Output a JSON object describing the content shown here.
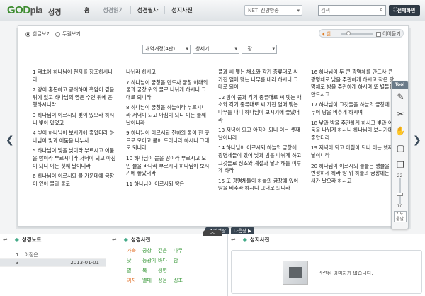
{
  "header": {
    "logo_main": "GOD",
    "logo_pia": "pia",
    "logo_sub": "성경",
    "nav": [
      "홈",
      "성경읽기",
      "성경필사",
      "성지사진"
    ],
    "net_label": "NET",
    "net_value": "진양방송",
    "search_placeholder": "검색",
    "fullscreen_label": "전체화면"
  },
  "controls": {
    "radio_korean": "한글보기",
    "radio_dual": "두권보기",
    "audio_icon": "◖ 한",
    "continuous_label": "이어듣기",
    "version": "개역개정(4판)",
    "book": "창세기",
    "chapter": "1장"
  },
  "columns": [
    [
      "1 태초에 하나님이 천지를 창조하시니라",
      "2 땅이 혼돈하고 공허하며 흑암이 깊음 위에 있고 하나님의 영은 수면 위에 운행하시니라",
      "3 하나님이 이르시되 빛이 있으라 하시니 빛이 있었고",
      "4 빛이 하나님이 보시기에 좋았더라 하나님이 빛과 어둠을 나누사",
      "5 하나님이 빛을 낮이라 부르시고 어둠을 밤이라 부르시니라 저녁이 되고 아침이 되니 이는 첫째 날이니라",
      "6 하나님이 이르시되 물 가운데에 궁창이 있어 물과 물로"
    ],
    [
      "나뉘라 하시고",
      "7 하나님이 궁창을 만드사 궁창 아래의 물과 궁창 위의 물로 나뉘게 하시니 그대로 되니라",
      "8 하나님이 궁창을 하늘이라 부르시니라 저녁이 되고 아침이 되니 이는 둘째 날이니라",
      "9 하나님이 이르시되 천하의 물이 한 곳으로 모이고 뭍이 드러나라 하시니 그대로 되니라",
      "10 하나님이 뭍을 땅이라 부르시고 모인 물을 바다라 부르시니 하나님이 보시기에 좋았더라",
      "11 하나님이 이르시되 땅은"
    ],
    [
      "풀과 씨 맺는 채소와 각기 종류대로 씨 가진 열매 맺는 나무를 내라 하시니 그대로 되어",
      "12 땅이 풀과 각기 종류대로 씨 맺는 채소와 각기 종류대로 씨 가진 열매 맺는 나무를 내니 하나님이 보시기에 좋았더라",
      "13 저녁이 되고 아침이 되니 이는 셋째 날이니라",
      "14 하나님이 이르시되 하늘의 궁창에 광명체들이 있어 낮과 밤을 나뉘게 하고 그것들로 징조와 계절과 날과 해를 이루게 하라",
      "15 또 광명체들이 하늘의 궁창에 있어 땅을 비추라 하시니 그대로 되니라"
    ],
    [
      "16 하나님이 두 큰 광명체를 만드사 큰 광명체로 낮을 주관하게 하시고 작은 광명체로 밤을 주관하게 하시며 또 별들을 만드시고",
      "17 하나님이 그것들을 하늘의 궁창에 두어 땅을 비추게 하시며",
      "18 낮과 밤을 주관하게 하시고 빛과 어둠을 나뉘게 하시니 하나님이 보시기에 좋았더라",
      "19 저녁이 되고 아침이 되니 이는 넷째 날이니라",
      "20 하나님이 이르시되 물들은 생물을 번성하게 하라 땅 위 하늘의 궁창에는 새가 날으라 하시고"
    ]
  ],
  "pager": {
    "prev": "◀ 이전장",
    "next": "다음장 ▶"
  },
  "tool": {
    "title": "Tool",
    "slider_top": "22",
    "slider_bottom": "10",
    "help": "? 도움말"
  },
  "bottom": {
    "toggle": "︿",
    "note_title": "성경노트",
    "notes": [
      {
        "no": "1",
        "author": "이정은",
        "date": ""
      },
      {
        "no": "3",
        "author": "",
        "date": "2013-01-01"
      }
    ],
    "dict_title": "성경사전",
    "dict": [
      [
        "가축",
        "궁창",
        "깊음",
        "나무"
      ],
      [
        "낮",
        "등광기",
        "바다",
        "밤"
      ],
      [
        "별",
        "복",
        "생명",
        ""
      ],
      [
        "여자",
        "열매",
        "정음",
        "징조"
      ]
    ],
    "photo_title": "성지사진",
    "photo_empty": "관련된 이미지가 없습니다."
  }
}
